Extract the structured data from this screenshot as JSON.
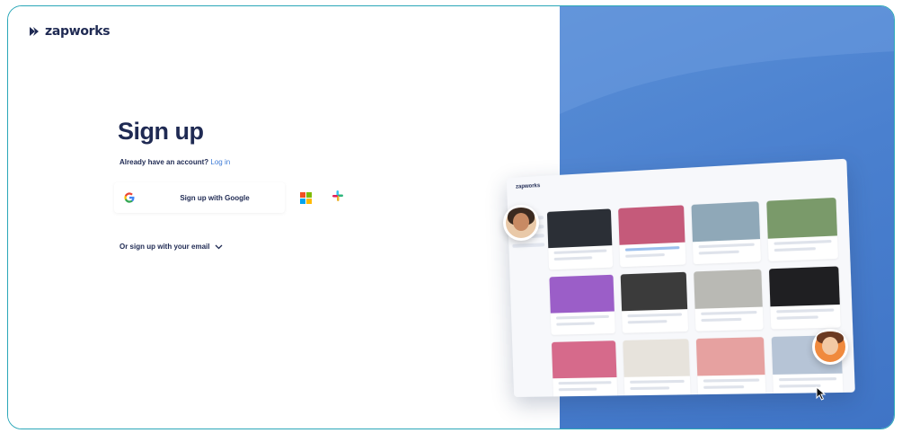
{
  "brand": {
    "name": "zapworks",
    "color": "#1f2a53"
  },
  "signup": {
    "title": "Sign up",
    "already_text": "Already have an account?",
    "login_link": "Log in",
    "google_label": "Sign up with Google",
    "email_toggle": "Or sign up with your email"
  },
  "icons": {
    "google": "google-icon",
    "microsoft": "microsoft-icon",
    "slack": "slack-icon",
    "chevron": "chevron-down-icon"
  },
  "colors": {
    "accent": "#3e7bd6",
    "panel_blue": "#4a80cf",
    "frame": "#2aa7b8"
  },
  "mockup": {
    "app_name": "zapworks"
  }
}
